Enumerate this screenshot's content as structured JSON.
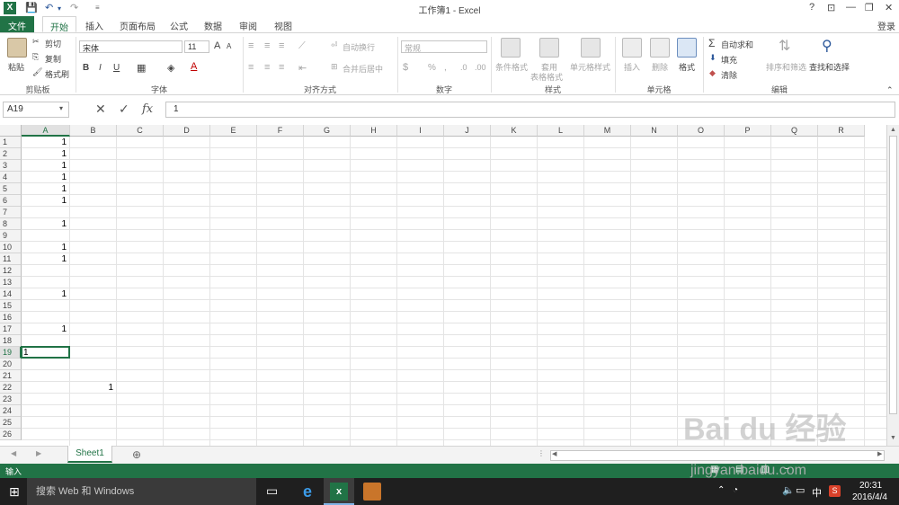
{
  "window": {
    "title": "工作簿1 - Excel",
    "login": "登录"
  },
  "quick_access": {
    "icons": [
      "save-icon",
      "undo-icon",
      "redo-icon"
    ]
  },
  "controls": [
    "?",
    "⊡",
    "—",
    "❐",
    "✕"
  ],
  "tabs": [
    {
      "label": "文件"
    },
    {
      "label": "开始"
    },
    {
      "label": "插入"
    },
    {
      "label": "页面布局"
    },
    {
      "label": "公式"
    },
    {
      "label": "数据"
    },
    {
      "label": "审阅"
    },
    {
      "label": "视图"
    }
  ],
  "ribbon": {
    "clipboard": {
      "label": "剪贴板",
      "paste": "粘贴",
      "cut": "剪切",
      "copy": "复制",
      "format_painter": "格式刷"
    },
    "font": {
      "label": "字体",
      "name": "宋体",
      "size": "11",
      "bold": "B",
      "italic": "I",
      "underline": "U",
      "grow": "A",
      "shrink": "A"
    },
    "alignment": {
      "label": "对齐方式",
      "wrap": "自动换行",
      "merge": "合并后居中"
    },
    "number": {
      "label": "数字",
      "format": "常规",
      "percent": "%",
      "comma": ","
    },
    "styles": {
      "label": "样式",
      "cond": "条件格式",
      "table1": "套用",
      "table2": "表格格式",
      "cell": "单元格样式"
    },
    "cells": {
      "label": "单元格",
      "insert": "插入",
      "delete": "删除",
      "format": "格式"
    },
    "editing": {
      "label": "编辑",
      "autosum": "自动求和",
      "fill": "填充",
      "clear": "清除",
      "sort": "排序和筛选",
      "find": "查找和选择"
    }
  },
  "formula_bar": {
    "name_box": "A19",
    "fx": "fx",
    "value": "1"
  },
  "columns": [
    "A",
    "B",
    "C",
    "D",
    "E",
    "F",
    "G",
    "H",
    "I",
    "J",
    "K",
    "L",
    "M",
    "N",
    "O",
    "P",
    "Q",
    "R"
  ],
  "rows": [
    "1",
    "2",
    "3",
    "4",
    "5",
    "6",
    "7",
    "8",
    "9",
    "10",
    "11",
    "12",
    "13",
    "14",
    "15",
    "16",
    "17",
    "18",
    "19",
    "20",
    "21",
    "22",
    "23",
    "24",
    "25",
    "26"
  ],
  "cells": {
    "A1": "1",
    "A2": "1",
    "A3": "1",
    "A4": "1",
    "A5": "1",
    "A6": "1",
    "A8": "1",
    "A10": "1",
    "A11": "1",
    "A14": "1",
    "A17": "1",
    "A19": "1",
    "B22": "1"
  },
  "sheet_tabs": {
    "active": "Sheet1",
    "add": "⊕"
  },
  "status": {
    "mode": "输入"
  },
  "taskbar": {
    "search": "搜索 Web 和 Windows",
    "time": "20:31",
    "date": "2016/4/4",
    "ime": "中"
  },
  "watermark": {
    "logo": "Bai du 经验",
    "url": "jingyan.baidu.com"
  },
  "colors": {
    "accent": "#217346",
    "taskbar": "#1f1f1f"
  }
}
